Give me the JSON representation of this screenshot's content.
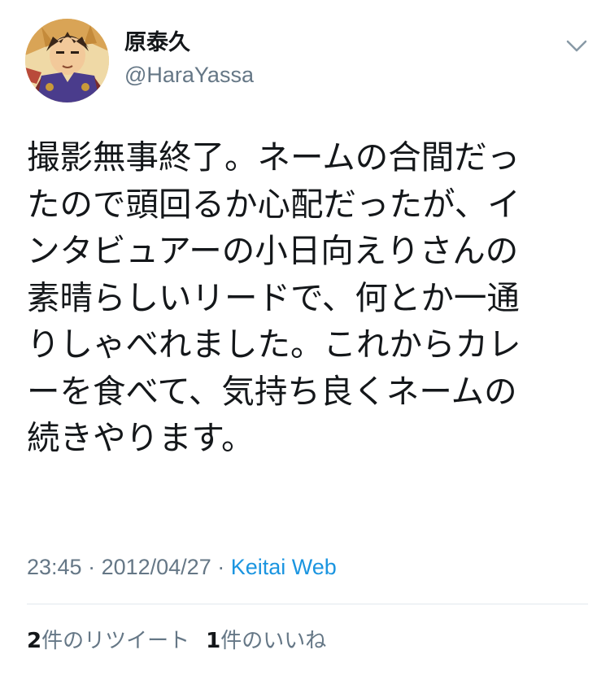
{
  "author": {
    "display_name": "原泰久",
    "handle": "@HaraYassa"
  },
  "tweet": {
    "lines": [
      "撮影無事終了。ネームの合間だっ",
      "たので頭回るか心配だったが、イ",
      "ンタビュアーの小日向えりさんの",
      "素晴らしいリードで、何とか一通",
      "りしゃべれました。これからカレ",
      "ーを食べて、気持ち良くネームの",
      "続きやります。"
    ],
    "time": "23:45",
    "separator": " · ",
    "date": "2012/04/27",
    "source": "Keitai Web"
  },
  "stats": {
    "retweets_count": "2",
    "retweets_label": "件のリツイート",
    "likes_count": "1",
    "likes_label": "件のいいね"
  },
  "icons": {
    "menu": "chevron-down-icon",
    "avatar": "profile-avatar"
  },
  "colors": {
    "text": "#14171a",
    "secondary": "#657786",
    "link": "#1b95e0",
    "divider": "#e1e8ed"
  }
}
